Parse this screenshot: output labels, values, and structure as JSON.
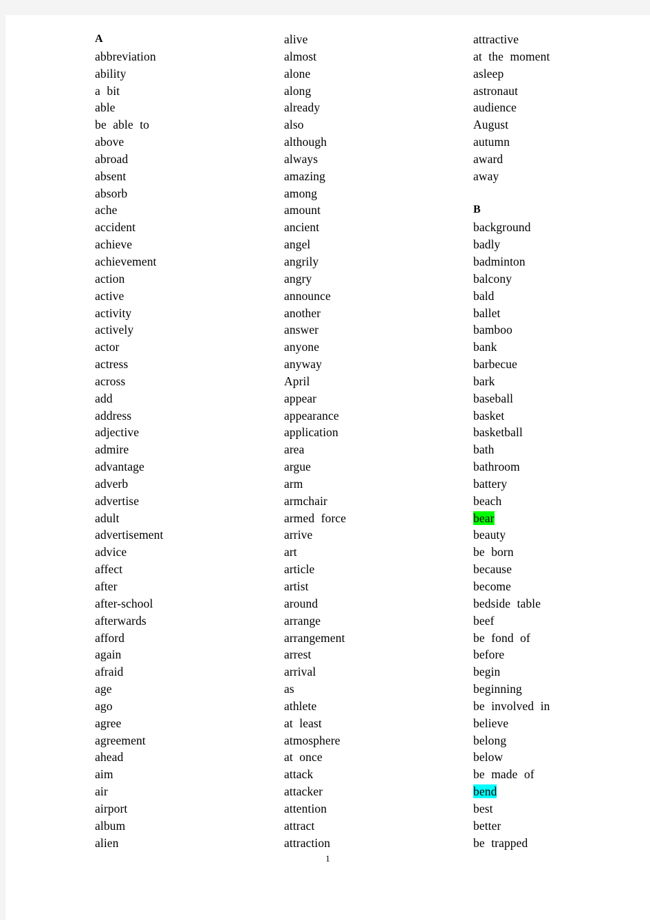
{
  "document": {
    "page_number": "1",
    "background_color": "#f4f4f4",
    "page_color": "#ffffff",
    "text_color": "#000000",
    "highlight_colors": {
      "green": "#00ff00",
      "cyan": "#00ffff"
    }
  },
  "columns": [
    {
      "id": "column-1",
      "entries": [
        {
          "text": "A",
          "type": "heading"
        },
        {
          "text": "abbreviation",
          "type": "word"
        },
        {
          "text": "ability",
          "type": "word"
        },
        {
          "text": "a bit",
          "type": "phrase"
        },
        {
          "text": "able",
          "type": "word"
        },
        {
          "text": "be able to",
          "type": "phrase"
        },
        {
          "text": "above",
          "type": "word"
        },
        {
          "text": "abroad",
          "type": "word"
        },
        {
          "text": "absent",
          "type": "word"
        },
        {
          "text": "absorb",
          "type": "word"
        },
        {
          "text": "ache",
          "type": "word"
        },
        {
          "text": "accident",
          "type": "word"
        },
        {
          "text": "achieve",
          "type": "word"
        },
        {
          "text": "achievement",
          "type": "word"
        },
        {
          "text": "action",
          "type": "word"
        },
        {
          "text": "active",
          "type": "word"
        },
        {
          "text": "activity",
          "type": "word"
        },
        {
          "text": "actively",
          "type": "word"
        },
        {
          "text": "actor",
          "type": "word"
        },
        {
          "text": "actress",
          "type": "word"
        },
        {
          "text": "across",
          "type": "word"
        },
        {
          "text": "add",
          "type": "word"
        },
        {
          "text": "address",
          "type": "word"
        },
        {
          "text": "adjective",
          "type": "word"
        },
        {
          "text": "admire",
          "type": "word"
        },
        {
          "text": "advantage",
          "type": "word"
        },
        {
          "text": "adverb",
          "type": "word"
        },
        {
          "text": "advertise",
          "type": "word"
        },
        {
          "text": "adult",
          "type": "word"
        },
        {
          "text": "advertisement",
          "type": "word"
        },
        {
          "text": "advice",
          "type": "word"
        },
        {
          "text": "affect",
          "type": "word"
        },
        {
          "text": "after",
          "type": "word"
        },
        {
          "text": "after-school",
          "type": "word"
        },
        {
          "text": "afterwards",
          "type": "word"
        },
        {
          "text": "afford",
          "type": "word"
        },
        {
          "text": "again",
          "type": "word"
        },
        {
          "text": "afraid",
          "type": "word"
        },
        {
          "text": "age",
          "type": "word"
        },
        {
          "text": "ago",
          "type": "word"
        },
        {
          "text": "agree",
          "type": "word"
        },
        {
          "text": "agreement",
          "type": "word"
        },
        {
          "text": "ahead",
          "type": "word"
        },
        {
          "text": "aim",
          "type": "word"
        },
        {
          "text": "air",
          "type": "word"
        },
        {
          "text": "airport",
          "type": "word"
        },
        {
          "text": "album",
          "type": "word"
        },
        {
          "text": "alien",
          "type": "word"
        }
      ]
    },
    {
      "id": "column-2",
      "entries": [
        {
          "text": "alive",
          "type": "word"
        },
        {
          "text": "almost",
          "type": "word"
        },
        {
          "text": "alone",
          "type": "word"
        },
        {
          "text": "along",
          "type": "word"
        },
        {
          "text": "already",
          "type": "word"
        },
        {
          "text": "also",
          "type": "word"
        },
        {
          "text": "although",
          "type": "word"
        },
        {
          "text": "always",
          "type": "word"
        },
        {
          "text": "amazing",
          "type": "word"
        },
        {
          "text": "among",
          "type": "word"
        },
        {
          "text": "amount",
          "type": "word"
        },
        {
          "text": "ancient",
          "type": "word"
        },
        {
          "text": "angel",
          "type": "word"
        },
        {
          "text": "angrily",
          "type": "word"
        },
        {
          "text": "angry",
          "type": "word"
        },
        {
          "text": "announce",
          "type": "word"
        },
        {
          "text": "another",
          "type": "word"
        },
        {
          "text": "answer",
          "type": "word"
        },
        {
          "text": "anyone",
          "type": "word"
        },
        {
          "text": "anyway",
          "type": "word"
        },
        {
          "text": "April",
          "type": "word"
        },
        {
          "text": "appear",
          "type": "word"
        },
        {
          "text": "appearance",
          "type": "word"
        },
        {
          "text": "application",
          "type": "word"
        },
        {
          "text": "area",
          "type": "word"
        },
        {
          "text": "argue",
          "type": "word"
        },
        {
          "text": "arm",
          "type": "word"
        },
        {
          "text": "armchair",
          "type": "word"
        },
        {
          "text": "armed force",
          "type": "phrase"
        },
        {
          "text": "arrive",
          "type": "word"
        },
        {
          "text": "art",
          "type": "word"
        },
        {
          "text": "article",
          "type": "word"
        },
        {
          "text": "artist",
          "type": "word"
        },
        {
          "text": "around",
          "type": "word"
        },
        {
          "text": "arrange",
          "type": "word"
        },
        {
          "text": "arrangement",
          "type": "word"
        },
        {
          "text": "arrest",
          "type": "word"
        },
        {
          "text": "arrival",
          "type": "word"
        },
        {
          "text": "as",
          "type": "word"
        },
        {
          "text": "athlete",
          "type": "word"
        },
        {
          "text": "at least",
          "type": "phrase"
        },
        {
          "text": "atmosphere",
          "type": "word"
        },
        {
          "text": "at once",
          "type": "phrase"
        },
        {
          "text": "attack",
          "type": "word"
        },
        {
          "text": "attacker",
          "type": "word"
        },
        {
          "text": "attention",
          "type": "word"
        },
        {
          "text": "attract",
          "type": "word"
        },
        {
          "text": "attraction",
          "type": "word"
        }
      ]
    },
    {
      "id": "column-3",
      "entries": [
        {
          "text": "attractive",
          "type": "word"
        },
        {
          "text": "at the moment",
          "type": "phrase"
        },
        {
          "text": "asleep",
          "type": "word"
        },
        {
          "text": "astronaut",
          "type": "word"
        },
        {
          "text": "audience",
          "type": "word"
        },
        {
          "text": "August",
          "type": "word"
        },
        {
          "text": "autumn",
          "type": "word"
        },
        {
          "text": "award",
          "type": "word"
        },
        {
          "text": "away",
          "type": "word"
        },
        {
          "text": "",
          "type": "spacer"
        },
        {
          "text": "B",
          "type": "heading"
        },
        {
          "text": "background",
          "type": "word"
        },
        {
          "text": "badly",
          "type": "word"
        },
        {
          "text": "badminton",
          "type": "word"
        },
        {
          "text": "balcony",
          "type": "word"
        },
        {
          "text": "bald",
          "type": "word"
        },
        {
          "text": "ballet",
          "type": "word"
        },
        {
          "text": "bamboo",
          "type": "word"
        },
        {
          "text": "bank",
          "type": "word"
        },
        {
          "text": "barbecue",
          "type": "word"
        },
        {
          "text": "bark",
          "type": "word"
        },
        {
          "text": "baseball",
          "type": "word"
        },
        {
          "text": "basket",
          "type": "word"
        },
        {
          "text": "basketball",
          "type": "word"
        },
        {
          "text": "bath",
          "type": "word"
        },
        {
          "text": "bathroom",
          "type": "word"
        },
        {
          "text": "battery",
          "type": "word"
        },
        {
          "text": "beach",
          "type": "word"
        },
        {
          "text": "bear",
          "type": "word",
          "highlight": "green"
        },
        {
          "text": "beauty",
          "type": "word"
        },
        {
          "text": "be born",
          "type": "phrase"
        },
        {
          "text": "because",
          "type": "word"
        },
        {
          "text": "become",
          "type": "word"
        },
        {
          "text": "bedside table",
          "type": "phrase"
        },
        {
          "text": "beef",
          "type": "word"
        },
        {
          "text": "be fond of",
          "type": "phrase"
        },
        {
          "text": "before",
          "type": "word"
        },
        {
          "text": "begin",
          "type": "word"
        },
        {
          "text": "beginning",
          "type": "word"
        },
        {
          "text": "be involved in",
          "type": "phrase"
        },
        {
          "text": "believe",
          "type": "word"
        },
        {
          "text": "belong",
          "type": "word"
        },
        {
          "text": "below",
          "type": "word"
        },
        {
          "text": "be made of",
          "type": "phrase"
        },
        {
          "text": "bend",
          "type": "word",
          "highlight": "cyan"
        },
        {
          "text": "best",
          "type": "word"
        },
        {
          "text": "better",
          "type": "word"
        },
        {
          "text": "be trapped",
          "type": "phrase"
        }
      ]
    }
  ]
}
